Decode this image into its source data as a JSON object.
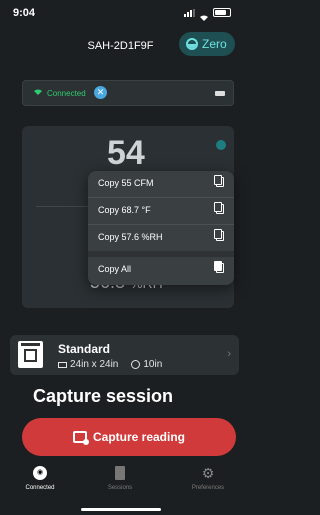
{
  "status": {
    "time": "9:04"
  },
  "header": {
    "device_name": "SAH-2D1F9F",
    "zero_label": "Zero"
  },
  "connection": {
    "status_text": "Connected"
  },
  "readings": {
    "primary_value_partial": "54",
    "rh_value": "56.8",
    "rh_unit": "%RH"
  },
  "context_menu": {
    "items": [
      {
        "label": "Copy 55 CFM"
      },
      {
        "label": "Copy 68.7 °F"
      },
      {
        "label": "Copy 57.6 %RH"
      },
      {
        "label": "Copy All"
      }
    ]
  },
  "filter": {
    "name": "Standard",
    "dimensions": "24in x 24in",
    "depth": "10in"
  },
  "capture": {
    "section_title": "Capture session",
    "button_label": "Capture reading"
  },
  "tabs": [
    {
      "label": "Connected"
    },
    {
      "label": "Sessions"
    },
    {
      "label": "Preferences"
    }
  ]
}
